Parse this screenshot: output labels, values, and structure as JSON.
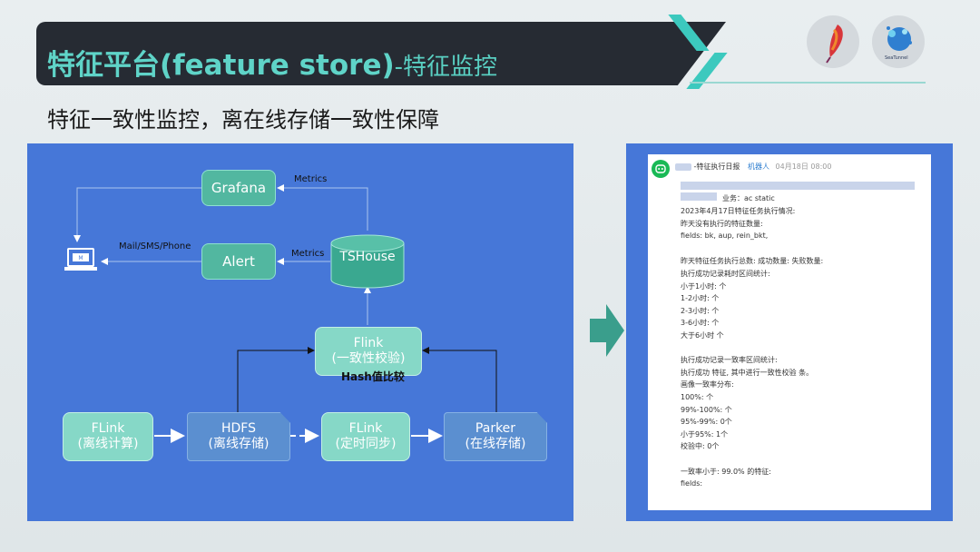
{
  "header": {
    "title_main": "特征平台(feature store)",
    "title_sub": "-特征监控"
  },
  "subtitle": "特征一致性监控，离在线存储一致性保障",
  "logos": {
    "left_icon": "apache-feather-icon",
    "right_label": "SeaTunnel"
  },
  "diagram": {
    "nodes": {
      "grafana": "Grafana",
      "alert": "Alert",
      "tshouse": "TSHouse",
      "flink_check_l1": "Flink",
      "flink_check_l2": "(一致性校验)",
      "flink_offline_l1": "FLink",
      "flink_offline_l2": "(离线计算)",
      "hdfs_l1": "HDFS",
      "hdfs_l2": "(离线存储)",
      "flink_sync_l1": "FLink",
      "flink_sync_l2": "(定时同步)",
      "parker_l1": "Parker",
      "parker_l2": "(在线存储)"
    },
    "labels": {
      "metrics_top": "Metrics",
      "metrics_mid": "Metrics",
      "mail": "Mail/SMS/Phone",
      "hash": "Hash值比较"
    }
  },
  "chat": {
    "header_sender": "-特征执行日报",
    "header_badge": "机器人",
    "header_time": "04月18日 08:00",
    "lines": [
      "业务：ac        static",
      "2023年4月17日特征任务执行情况:",
      "昨天没有执行的特征数量:",
      "fields: bk, aup, rein_bkt,",
      "",
      "昨天特征任务执行总数:       成功数量:       失败数量:",
      "执行成功记录耗时区间统计:",
      "小于1小时:     个",
      "1-2小时:     个",
      "2-3小时:     个",
      "3-6小时:     个",
      "大于6小时     个",
      "",
      "执行成功记录一致率区间统计:",
      "执行成功        特征, 其中进行一致性校验      条。",
      "画像一致率分布:",
      "100%:     个",
      "99%-100%:     个",
      "95%-99%: 0个",
      "小于95%: 1个",
      "校验中: 0个",
      "",
      "一致率小于: 99.0% 的特征:",
      "fields:"
    ]
  },
  "colors": {
    "accent": "#3cc9be",
    "diagram_bg": "#4677d8",
    "node_green": "#52b7a0",
    "title_bar": "#262b33"
  }
}
